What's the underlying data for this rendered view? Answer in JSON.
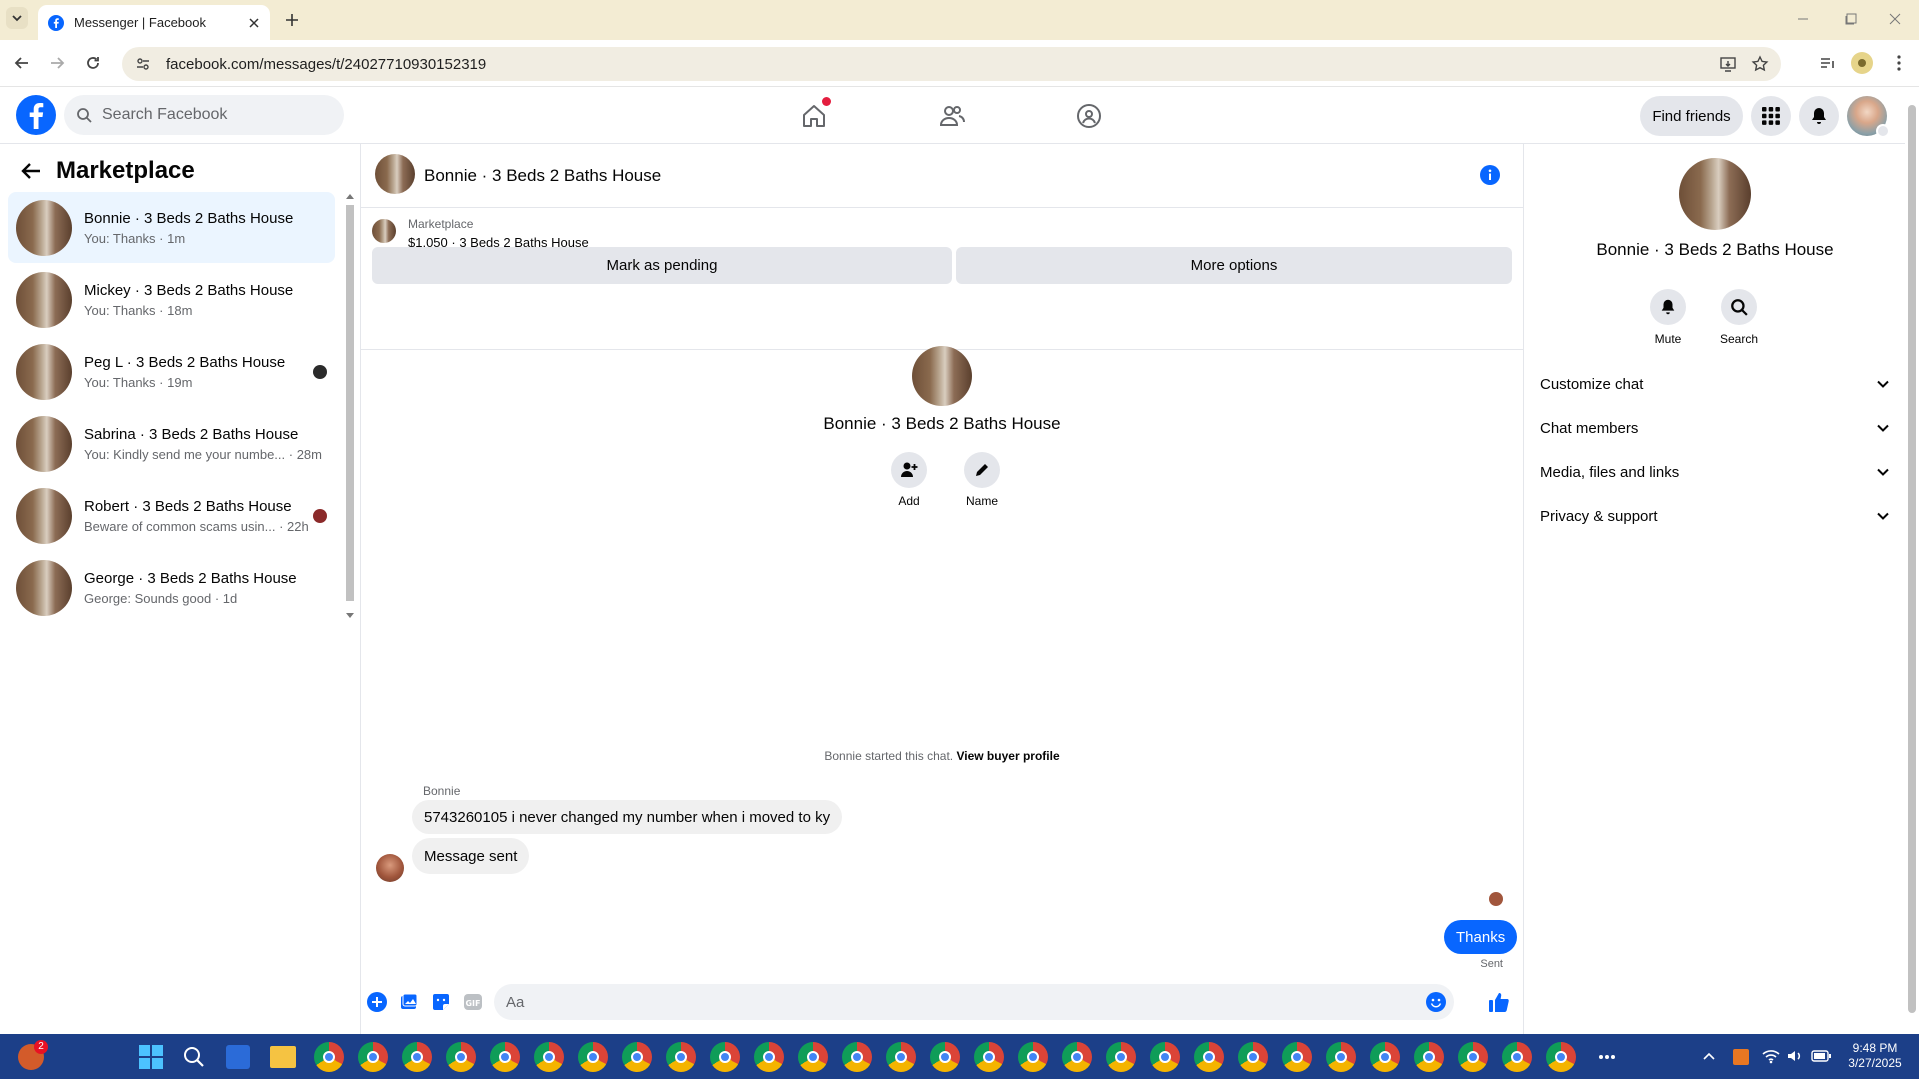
{
  "browser": {
    "tab_title": "Messenger | Facebook",
    "url": "facebook.com/messages/t/24027710930152319",
    "window_controls": [
      "minimize-icon",
      "restore-icon",
      "close-icon"
    ]
  },
  "fb_header": {
    "search_placeholder": "Search Facebook",
    "find_friends_label": "Find friends"
  },
  "sidebar": {
    "title": "Marketplace",
    "conversations": [
      {
        "name": "Bonnie · 3 Beds 2 Baths House",
        "preview": "You: Thanks · 1m",
        "selected": true
      },
      {
        "name": "Mickey · 3 Beds 2 Baths House",
        "preview": "You: Thanks · 18m"
      },
      {
        "name": "Peg L · 3 Beds 2 Baths House",
        "preview": "You: Thanks · 19m"
      },
      {
        "name": "Sabrina · 3 Beds 2 Baths House",
        "preview": "You: Kindly send me your numbe... · 28m"
      },
      {
        "name": "Robert · 3 Beds 2 Baths House",
        "preview": "Beware of common scams usin... · 22h"
      },
      {
        "name": "George · 3 Beds 2 Baths House",
        "preview": "George: Sounds good · 1d"
      }
    ]
  },
  "chat": {
    "title": "Bonnie · 3 Beds 2 Baths House",
    "listing_source": "Marketplace",
    "listing_info": "$1,050 · 3 Beds 2 Baths House",
    "mark_pending_label": "Mark as pending",
    "more_options_label": "More options",
    "profile_name": "Bonnie · 3 Beds 2 Baths House",
    "add_label": "Add",
    "name_label": "Name",
    "started_text": "Bonnie started this chat.",
    "buyer_profile_link": "View buyer profile",
    "sender_name": "Bonnie",
    "message_1": "5743260105 i never changed my number when i moved to ky",
    "message_2": "Message sent",
    "outgoing_message": "Thanks",
    "sent_status": "Sent",
    "composer_placeholder": "Aa"
  },
  "details": {
    "name": "Bonnie · 3 Beds 2 Baths House",
    "mute_label": "Mute",
    "search_label": "Search",
    "sections": [
      "Customize chat",
      "Chat members",
      "Media, files and links",
      "Privacy & support"
    ]
  },
  "taskbar": {
    "time": "9:48 PM",
    "date": "3/27/2025",
    "notification_badge": "2"
  },
  "colors": {
    "fb_blue": "#0866ff",
    "selected_row": "#ebf5ff",
    "taskbar": "#1c3f88"
  }
}
